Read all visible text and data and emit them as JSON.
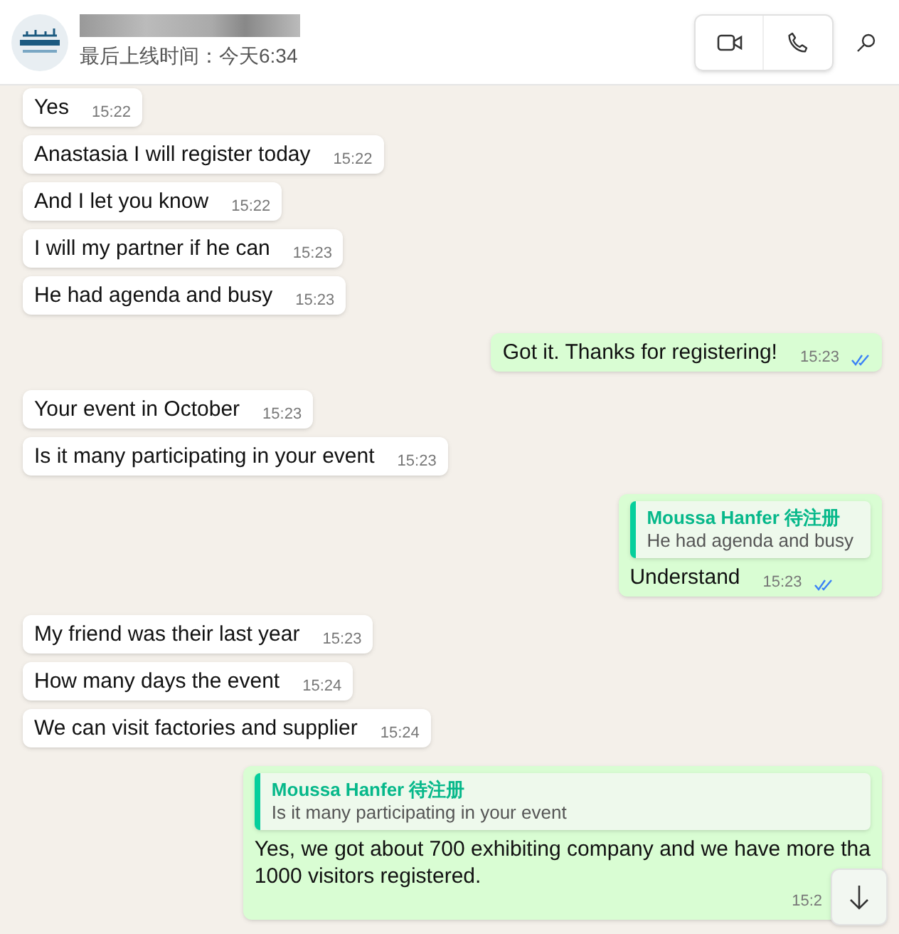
{
  "header": {
    "status": "最后上线时间：今天6:34"
  },
  "messages": [
    {
      "outgoing": false,
      "text": "Yes",
      "time": "15:22"
    },
    {
      "outgoing": false,
      "text": "Anastasia I will register today",
      "time": "15:22"
    },
    {
      "outgoing": false,
      "text": "And I let you know",
      "time": "15:22"
    },
    {
      "outgoing": false,
      "text": "I will my partner if he can",
      "time": "15:23"
    },
    {
      "outgoing": false,
      "text": "He had agenda and busy",
      "time": "15:23"
    },
    {
      "outgoing": true,
      "text": "Got it. Thanks for registering!",
      "time": "15:23",
      "read": true
    },
    {
      "outgoing": false,
      "text": "Your event in October",
      "time": "15:23"
    },
    {
      "outgoing": false,
      "text": "Is it many participating in your event",
      "time": "15:23"
    },
    {
      "outgoing": true,
      "quote": {
        "author": "Moussa Hanfer 待注册",
        "text": "He had agenda and busy"
      },
      "text": "Understand",
      "time": "15:23",
      "read": true
    },
    {
      "outgoing": false,
      "text": "My friend was their last year",
      "time": "15:23"
    },
    {
      "outgoing": false,
      "text": "How many days the event",
      "time": "15:24"
    },
    {
      "outgoing": false,
      "text": "We can visit factories and supplier",
      "time": "15:24"
    },
    {
      "outgoing": true,
      "quote": {
        "author": "Moussa Hanfer 待注册",
        "text": "Is it many participating in your event"
      },
      "lines": [
        "Yes, we got about 700 exhibiting company and we have more tha",
        "1000 visitors registered."
      ],
      "time": "15:2"
    }
  ]
}
